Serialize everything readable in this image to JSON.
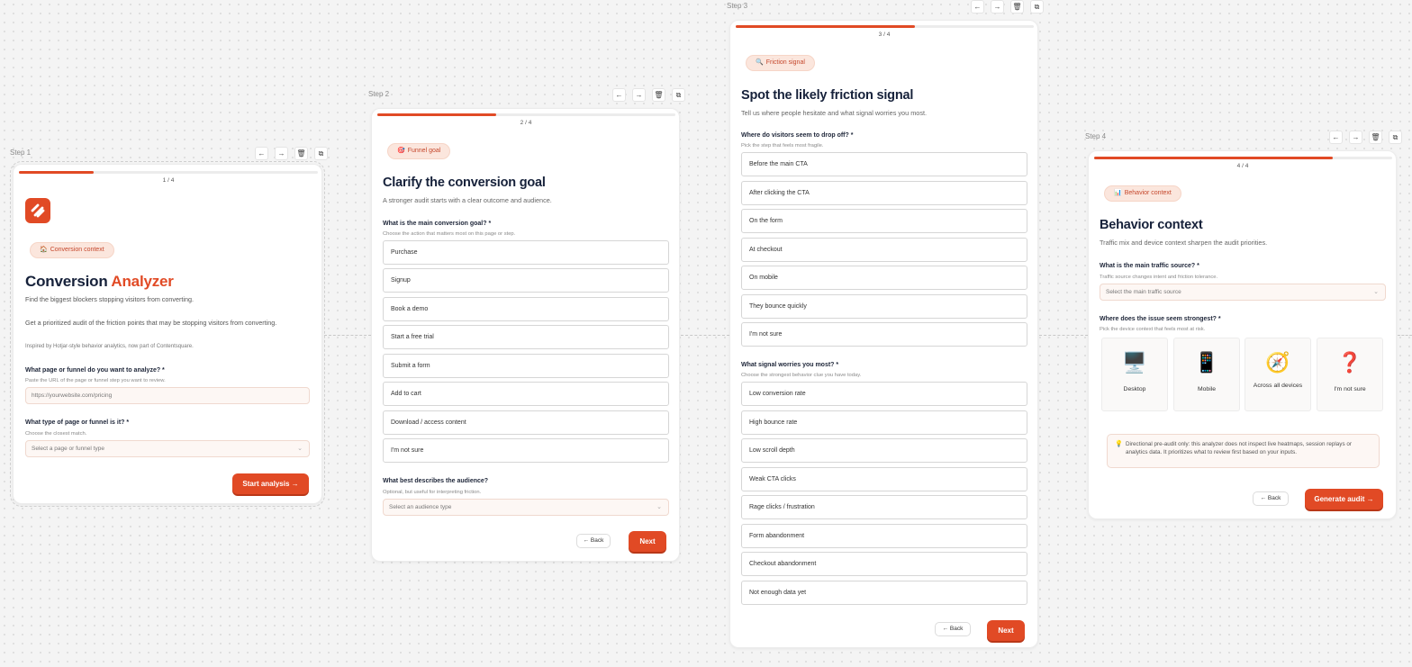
{
  "toolbar_icons": [
    "arrow-left-icon",
    "arrow-right-icon",
    "trash-icon",
    "duplicate-icon"
  ],
  "toolbar_glyphs": {
    "left": "←",
    "right": "→",
    "trash": "🗑",
    "copy": "⧉"
  },
  "colors": {
    "accent": "#e14a25",
    "chip_bg": "#fbe6dd",
    "title": "#16213a"
  },
  "step1": {
    "label": "Step 1",
    "progress": 0.25,
    "progress_text": "1 / 4",
    "chip": "Conversion context",
    "chip_icon": "🏠",
    "title_part1": "Conversion ",
    "title_part2": "Analyzer",
    "subtitle": "Find the biggest blockers stopping visitors from converting.",
    "description": "Get a prioritized audit of the friction points that may be stopping visitors from converting.",
    "attribution": "Inspired by Hotjar-style behavior analytics, now part of Contentsquare.",
    "q1_label": "What page or funnel do you want to analyze? *",
    "q1_hint": "Paste the URL of the page or funnel step you want to review.",
    "q1_placeholder": "https://yourwebsite.com/pricing",
    "q2_label": "What type of page or funnel is it? *",
    "q2_hint": "Choose the closest match.",
    "q2_placeholder": "Select a page or funnel type",
    "start_button": "Start analysis →"
  },
  "step2": {
    "label": "Step 2",
    "progress": 0.5,
    "progress_text": "2 / 4",
    "chip": "Funnel goal",
    "chip_icon": "🎯",
    "title": "Clarify the conversion goal",
    "subtitle": "A stronger audit starts with a clear outcome and audience.",
    "q1_label": "What is the main conversion goal? *",
    "q1_hint": "Choose the action that matters most on this page or step.",
    "options": [
      "Purchase",
      "Signup",
      "Book a demo",
      "Start a free trial",
      "Submit a form",
      "Add to cart",
      "Download / access content",
      "I'm not sure"
    ],
    "q2_label": "What best describes the audience?",
    "q2_hint": "Optional, but useful for interpreting friction.",
    "q2_placeholder": "Select an audience type",
    "back_button": "← Back",
    "next_button": "Next"
  },
  "step3": {
    "label": "Step 3",
    "progress": 0.75,
    "progress_text": "3 / 4",
    "chip": "Friction signal",
    "chip_icon": "🔍",
    "title": "Spot the likely friction signal",
    "subtitle": "Tell us where people hesitate and what signal worries you most.",
    "q1_label": "Where do visitors seem to drop off? *",
    "q1_hint": "Pick the step that feels most fragile.",
    "options1": [
      "Before the main CTA",
      "After clicking the CTA",
      "On the form",
      "At checkout",
      "On mobile",
      "They bounce quickly",
      "I'm not sure"
    ],
    "q2_label": "What signal worries you most? *",
    "q2_hint": "Choose the strongest behavior clue you have today.",
    "options2": [
      "Low conversion rate",
      "High bounce rate",
      "Low scroll depth",
      "Weak CTA clicks",
      "Rage clicks / frustration",
      "Form abandonment",
      "Checkout abandonment",
      "Not enough data yet"
    ],
    "back_button": "← Back",
    "next_button": "Next"
  },
  "step4": {
    "label": "Step 4",
    "progress": 0.8,
    "progress_text": "4 / 4",
    "chip": "Behavior context",
    "chip_icon": "📊",
    "title": "Behavior context",
    "subtitle": "Traffic mix and device context sharpen the audit priorities.",
    "q1_label": "What is the main traffic source? *",
    "q1_hint": "Traffic source changes intent and friction tolerance.",
    "q1_placeholder": "Select the main traffic source",
    "q2_label": "Where does the issue seem strongest? *",
    "q2_hint": "Pick the device context that feels most at risk.",
    "devices": [
      {
        "label": "Desktop",
        "icon": "🖥️"
      },
      {
        "label": "Mobile",
        "icon": "📱"
      },
      {
        "label": "Across all devices",
        "icon": "🧭"
      },
      {
        "label": "I'm not sure",
        "icon": "❓"
      }
    ],
    "note_icon": "💡",
    "note": "Directional pre-audit only: this analyzer does not inspect live heatmaps, session replays or analytics data. It prioritizes what to review first based on your inputs.",
    "back_button": "← Back",
    "generate_button": "Generate audit →"
  }
}
